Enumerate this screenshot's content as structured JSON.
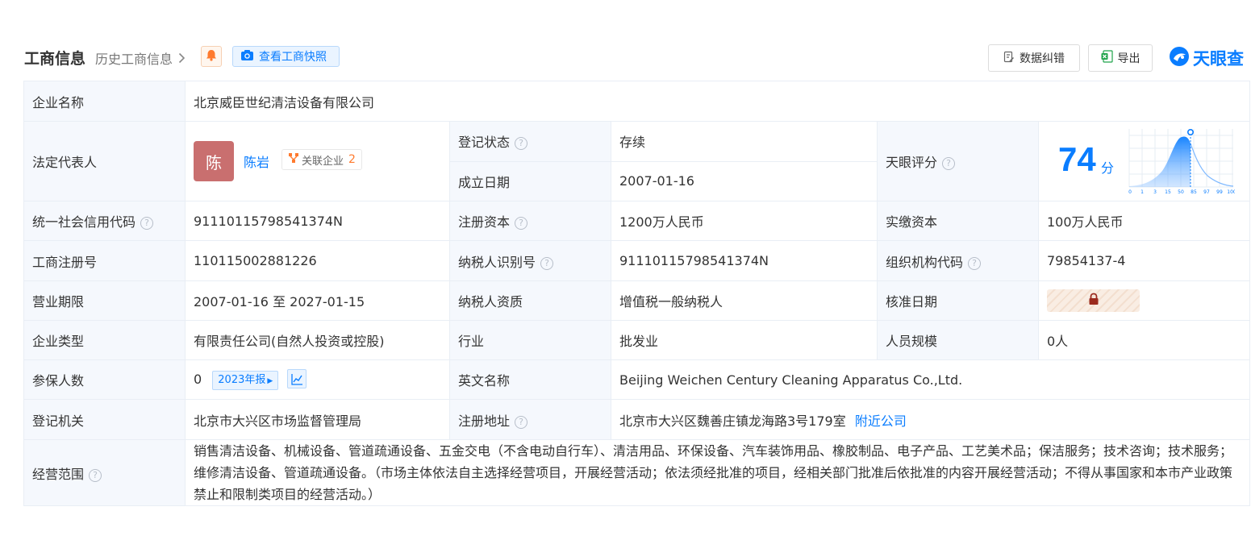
{
  "header": {
    "title": "工商信息",
    "history_link": "历史工商信息",
    "snapshot_label": "查看工商快照",
    "correct_label": "数据纠错",
    "export_label": "导出",
    "logo_text": "天眼查"
  },
  "colors": {
    "accent": "#0a7dff",
    "status_green": "#1fa34a",
    "avatar_bg": "#c96f6f",
    "badge_orange": "#ff7a2e"
  },
  "company": {
    "name_label": "企业名称",
    "name_value": "北京威臣世纪清洁设备有限公司",
    "legal_rep_label": "法定代表人",
    "legal_rep_avatar": "陈",
    "legal_rep_name": "陈岩",
    "related_label": "关联企业",
    "related_count": "2",
    "status_label": "登记状态",
    "status_value": "存续",
    "found_label": "成立日期",
    "found_value": "2007-01-16",
    "score_label": "天眼评分",
    "score_value": "74",
    "score_unit": "分",
    "score_axis": [
      "0",
      "1",
      "3",
      "15",
      "50",
      "85",
      "97",
      "99",
      "100"
    ],
    "credit_label": "统一社会信用代码",
    "credit_value": "91110115798541374N",
    "reg_capital_label": "注册资本",
    "reg_capital_value": "1200万人民币",
    "paid_capital_label": "实缴资本",
    "paid_capital_value": "100万人民币",
    "reg_no_label": "工商注册号",
    "reg_no_value": "110115002881226",
    "taxpayer_id_label": "纳税人识别号",
    "taxpayer_id_value": "91110115798541374N",
    "org_code_label": "组织机构代码",
    "org_code_value": "79854137-4",
    "term_label": "营业期限",
    "term_value": "2007-01-16 至 2027-01-15",
    "taxpayer_qual_label": "纳税人资质",
    "taxpayer_qual_value": "增值税一般纳税人",
    "approve_label": "核准日期",
    "type_label": "企业类型",
    "type_value": "有限责任公司(自然人投资或控股)",
    "industry_label": "行业",
    "industry_value": "批发业",
    "staff_label": "人员规模",
    "staff_value": "0人",
    "insured_label": "参保人数",
    "insured_value": "0",
    "insured_year_badge": "2023年报",
    "english_label": "英文名称",
    "english_value": "Beijing Weichen Century Cleaning Apparatus Co.,Ltd.",
    "authority_label": "登记机关",
    "authority_value": "北京市大兴区市场监督管理局",
    "address_label": "注册地址",
    "address_value": "北京市大兴区魏善庄镇龙海路3号179室",
    "nearby_link": "附近公司",
    "scope_label": "经营范围",
    "scope_value": "销售清洁设备、机械设备、管道疏通设备、五金交电（不含电动自行车）、清洁用品、环保设备、汽车装饰用品、橡胶制品、电子产品、工艺美术品；保洁服务；技术咨询；技术服务；维修清洁设备、管道疏通设备。（市场主体依法自主选择经营项目，开展经营活动；依法须经批准的项目，经相关部门批准后依批准的内容开展经营活动；不得从事国家和本市产业政策禁止和限制类项目的经营活动。）"
  }
}
